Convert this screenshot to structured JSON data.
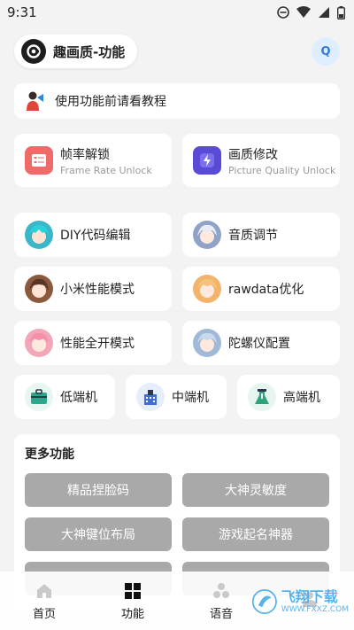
{
  "status": {
    "time": "9:31"
  },
  "header": {
    "app_title": "趣画质-功能",
    "q_label": "Q"
  },
  "notice": {
    "text": "使用功能前请看教程"
  },
  "top_tiles": [
    {
      "label": "帧率解锁",
      "sub": "Frame Rate Unlock",
      "color": "#f06a6a"
    },
    {
      "label": "画质修改",
      "sub": "Picture Quality Unlock",
      "color": "#5a4bd6"
    }
  ],
  "grid_tiles": [
    {
      "label": "DIY代码编辑",
      "color": "#39b7c9"
    },
    {
      "label": "音质调节",
      "color": "#8fa3c8"
    },
    {
      "label": "小米性能模式",
      "color": "#8b5a3c"
    },
    {
      "label": "rawdata优化",
      "color": "#f2b36b"
    },
    {
      "label": "性能全开模式",
      "color": "#f3a6b8"
    },
    {
      "label": "陀螺仪配置",
      "color": "#9fb9d6"
    }
  ],
  "tier_tiles": [
    {
      "label": "低端机",
      "color": "#2aa98a"
    },
    {
      "label": "中端机",
      "color": "#3f6fd1"
    },
    {
      "label": "高端机",
      "color": "#2fa27c"
    }
  ],
  "more": {
    "title": "更多功能",
    "buttons": [
      "精品捏脸码",
      "大神灵敏度",
      "大神键位布局",
      "游戏起名神器",
      "",
      ""
    ]
  },
  "nav": [
    {
      "label": "首页"
    },
    {
      "label": "功能"
    },
    {
      "label": "语音"
    },
    {
      "label": ""
    }
  ],
  "watermark": {
    "text": "飞翔下载",
    "sub": "WWW.FXXZ.COM"
  }
}
